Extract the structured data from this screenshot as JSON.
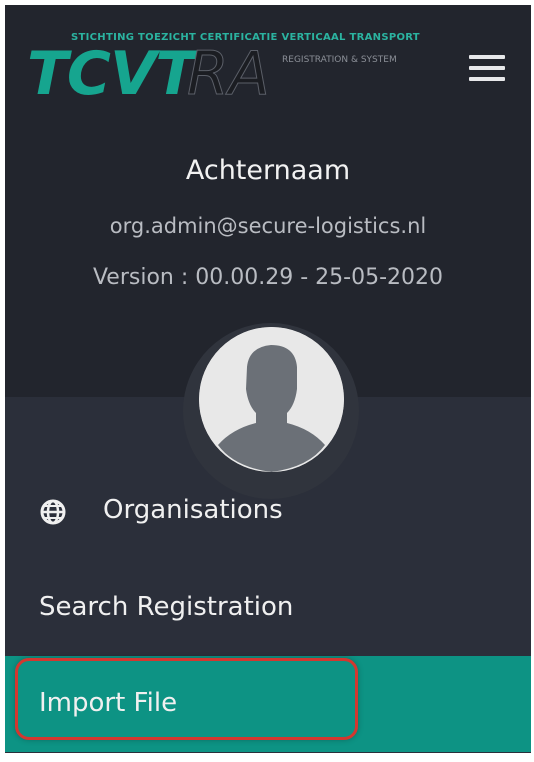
{
  "logo": {
    "tagline": "STICHTING TOEZICHT CERTIFICATIE VERTICAAL TRANSPORT",
    "brand": "TCVT",
    "brand_suffix": "RA",
    "subtext": "REGISTRATION & SYSTEM"
  },
  "header": {
    "menu_icon": "hamburger-menu-icon"
  },
  "user": {
    "name": "Achternaam",
    "email": "org.admin@secure-logistics.nl",
    "version": "Version : 00.00.29 - 25-05-2020",
    "avatar_icon": "user-silhouette-icon"
  },
  "menu": {
    "items": [
      {
        "label": "Organisations",
        "icon": "globe-icon",
        "active": false
      },
      {
        "label": "Search Registration",
        "icon": null,
        "active": false
      },
      {
        "label": "Import File",
        "icon": null,
        "active": true
      }
    ]
  },
  "colors": {
    "header_bg": "#22252d",
    "body_bg": "#2b2f3a",
    "accent": "#0d9384",
    "brand_teal": "#16a58f",
    "highlight_border": "#d3372f"
  }
}
